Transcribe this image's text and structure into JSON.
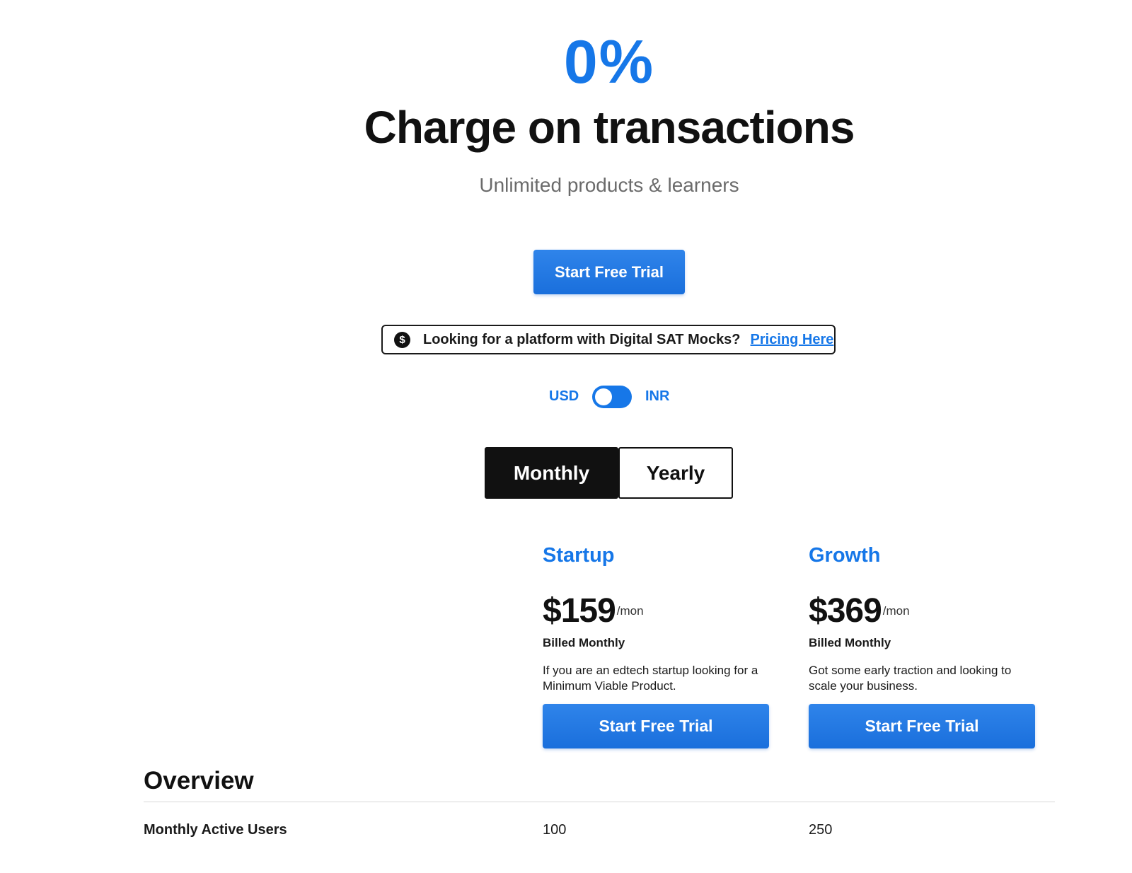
{
  "hero": {
    "percent": "0%",
    "title": "Charge on transactions",
    "subtitle": "Unlimited products & learners",
    "cta_label": "Start Free Trial"
  },
  "sat_banner": {
    "icon": "dollar-circle-icon",
    "text": "Looking for a platform with Digital SAT Mocks?",
    "link_label": "Pricing Here"
  },
  "currency": {
    "left": "USD",
    "right": "INR",
    "selected": "USD"
  },
  "billing": {
    "monthly_label": "Monthly",
    "yearly_label": "Yearly",
    "selected": "Monthly"
  },
  "plans": [
    {
      "name": "Startup",
      "price": "$159",
      "unit": "/mon",
      "billed": "Billed Monthly",
      "description": "If you are an edtech startup looking for a Minimum Viable Product.",
      "cta_label": "Start Free Trial"
    },
    {
      "name": "Growth",
      "price": "$369",
      "unit": "/mon",
      "billed": "Billed Monthly",
      "description": "Got some early traction and looking to scale your business.",
      "cta_label": "Start Free Trial"
    }
  ],
  "overview": {
    "title": "Overview",
    "rows": [
      {
        "label": "Monthly Active Users",
        "values": [
          "100",
          "250"
        ]
      }
    ]
  },
  "colors": {
    "accent": "#1677e8",
    "dark": "#111111",
    "muted": "#6b6b6b"
  }
}
